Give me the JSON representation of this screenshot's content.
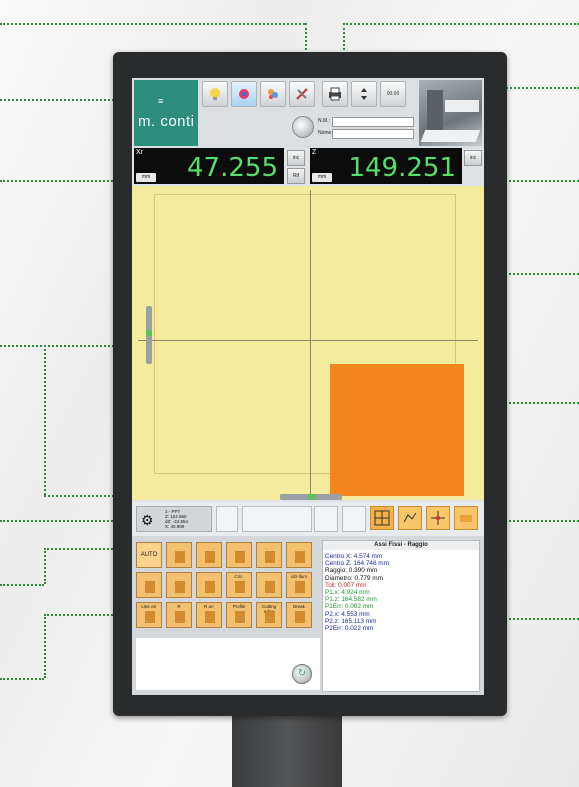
{
  "brand": {
    "logo_mark": "≡",
    "name": "m. conti"
  },
  "toolbar": {
    "buttons": [
      {
        "icon": "lightbulb-icon",
        "label": ""
      },
      {
        "icon": "probe-icon",
        "label": ""
      },
      {
        "icon": "palette-icon",
        "label": ""
      },
      {
        "icon": "tools-icon",
        "label": ""
      },
      {
        "icon": "printer-icon",
        "label": ""
      },
      {
        "icon": "arrows-icon",
        "label": ""
      },
      {
        "icon": "zero-icon",
        "label": "00.00"
      }
    ],
    "field1_label": "N.M.:",
    "field2_label": "Nome:"
  },
  "readouts": [
    {
      "axis": "Xr",
      "value": "47.255",
      "unit": "mm",
      "btn_top": "inc",
      "btn_bottom": "Rif"
    },
    {
      "axis": "Z",
      "value": "149.251",
      "unit": "mm",
      "btn_top": "inc"
    }
  ],
  "info_panel": {
    "line1": "1 - PPT",
    "line2": "Z: 124.960",
    "line3": "dZ: -24.554",
    "line4": "X: 40.990"
  },
  "keypad": {
    "row1": [
      "AUTO",
      "",
      "",
      "",
      "",
      ""
    ],
    "row2": [
      "",
      "",
      "",
      "Circ.",
      "",
      "ultr-llum"
    ],
    "row3": [
      "Line arr",
      "R",
      "R arr",
      "Profile",
      "Cutting edge",
      "Break"
    ]
  },
  "results": {
    "title": "Assi Fissi - Raggio",
    "lines": [
      {
        "text": "Centro X: 4.574 mm",
        "color": "#1a2aa8"
      },
      {
        "text": "Centro Z: 164.746 mm",
        "color": "#1a2aa8"
      },
      {
        "text": "Raggio: 0.390 mm",
        "color": "#111111"
      },
      {
        "text": "Diametro: 0.779 mm",
        "color": "#111111"
      },
      {
        "text": "Toll: 0.007 mm",
        "color": "#d81e1e"
      },
      {
        "text": "P1.x: 4.924 mm",
        "color": "#1f9a2a"
      },
      {
        "text": "P1.z: 164.582 mm",
        "color": "#1f9a2a"
      },
      {
        "text": "P1Err: 0.002 mm",
        "color": "#1f9a2a"
      },
      {
        "text": "P2.x: 4.553 mm",
        "color": "#1a2aa8"
      },
      {
        "text": "P2.z: 165.113 mm",
        "color": "#1a2aa8"
      },
      {
        "text": "P2Err: 0.022 mm",
        "color": "#1a2aa8"
      }
    ]
  },
  "colors": {
    "accent": "#2d8e7c",
    "readout_green": "#56e06a",
    "callout": "#2f8a3a",
    "view_bg": "#f4ec9c",
    "measure_area": "#f5861f"
  }
}
